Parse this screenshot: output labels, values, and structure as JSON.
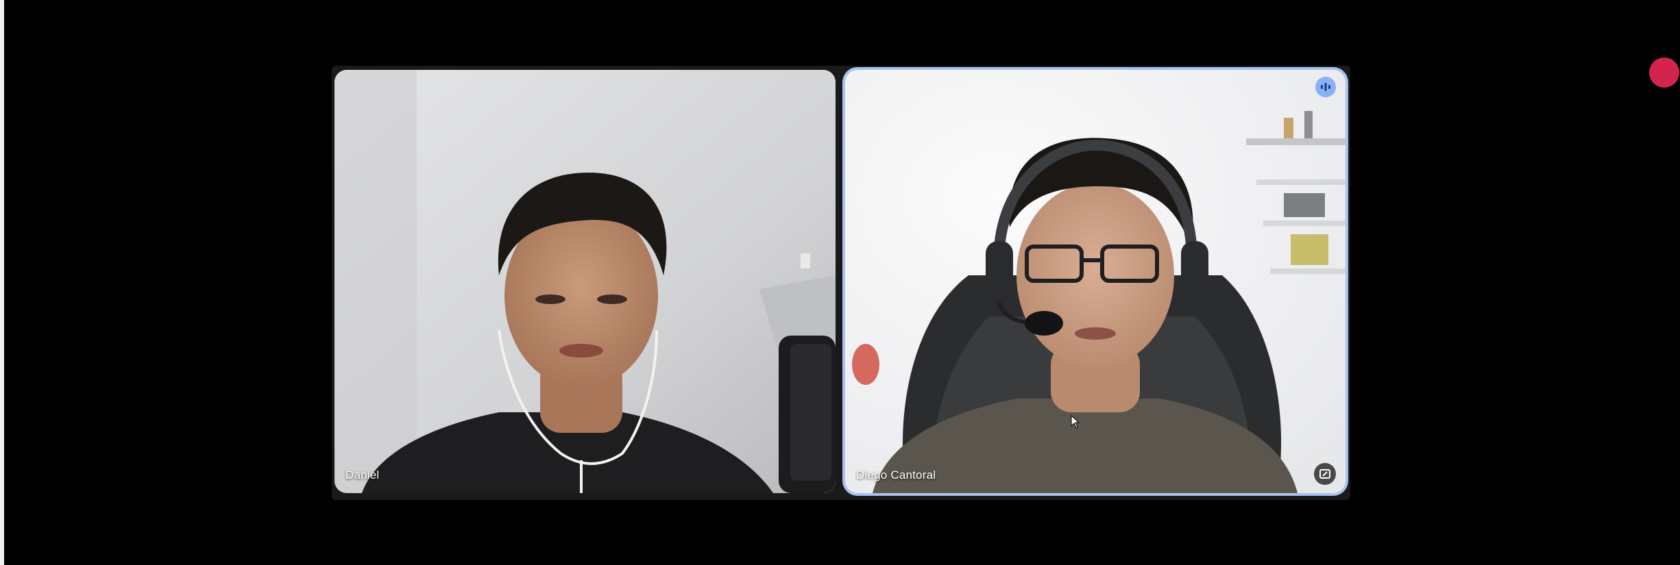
{
  "participants": [
    {
      "name": "Daniel",
      "speaking": false
    },
    {
      "name": "Diego Cantoral",
      "speaking": true
    }
  ],
  "icons": {
    "speaking": "audio-wave-icon",
    "pin": "pin-tile-icon",
    "recording": "recording-dot-icon"
  },
  "colors": {
    "background": "#000000",
    "active_speaker_border": "#a9c1ee",
    "speaking_badge": "#8ab0f5",
    "recording_indicator": "#d3234f"
  }
}
